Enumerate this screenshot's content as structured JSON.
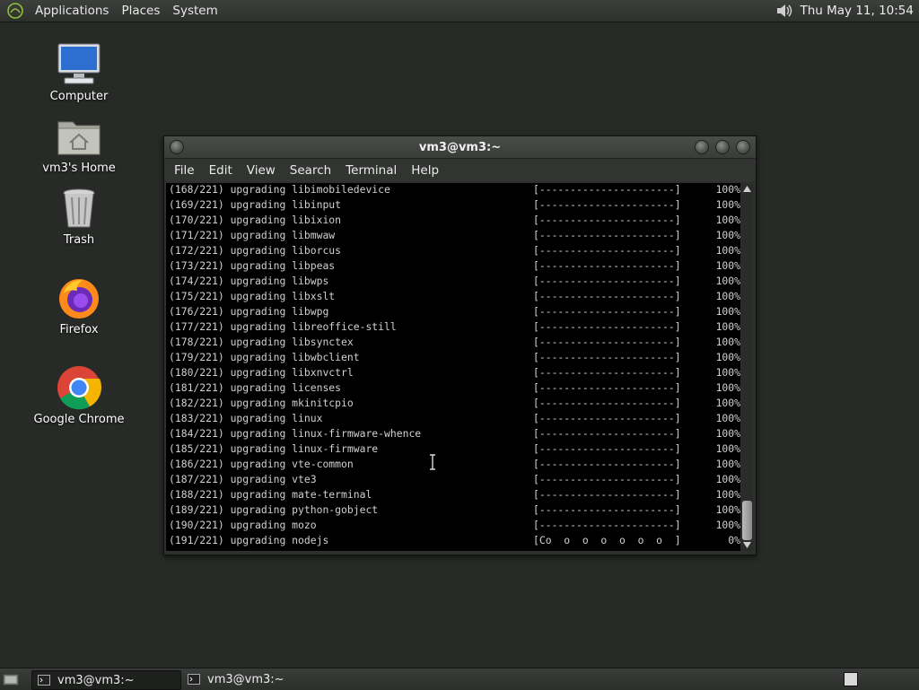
{
  "top_panel": {
    "menus": [
      "Applications",
      "Places",
      "System"
    ],
    "clock": "Thu May 11, 10:54",
    "volume_icon": "speaker-icon"
  },
  "desktop_icons": [
    {
      "label": "Computer",
      "icon": "computer-icon"
    },
    {
      "label": "vm3's Home",
      "icon": "home-folder-icon"
    },
    {
      "label": "Trash",
      "icon": "trash-icon"
    },
    {
      "label": "Firefox",
      "icon": "firefox-icon"
    },
    {
      "label": "Google Chrome",
      "icon": "chrome-icon"
    }
  ],
  "terminal": {
    "title": "vm3@vm3:~",
    "menu": [
      "File",
      "Edit",
      "View",
      "Search",
      "Terminal",
      "Help"
    ],
    "lines": [
      {
        "text": "(168/221) upgrading libimobiledevice",
        "bar": "[----------------------]",
        "pct": "100%"
      },
      {
        "text": "(169/221) upgrading libinput",
        "bar": "[----------------------]",
        "pct": "100%"
      },
      {
        "text": "(170/221) upgrading libixion",
        "bar": "[----------------------]",
        "pct": "100%"
      },
      {
        "text": "(171/221) upgrading libmwaw",
        "bar": "[----------------------]",
        "pct": "100%"
      },
      {
        "text": "(172/221) upgrading liborcus",
        "bar": "[----------------------]",
        "pct": "100%"
      },
      {
        "text": "(173/221) upgrading libpeas",
        "bar": "[----------------------]",
        "pct": "100%"
      },
      {
        "text": "(174/221) upgrading libwps",
        "bar": "[----------------------]",
        "pct": "100%"
      },
      {
        "text": "(175/221) upgrading libxslt",
        "bar": "[----------------------]",
        "pct": "100%"
      },
      {
        "text": "(176/221) upgrading libwpg",
        "bar": "[----------------------]",
        "pct": "100%"
      },
      {
        "text": "(177/221) upgrading libreoffice-still",
        "bar": "[----------------------]",
        "pct": "100%"
      },
      {
        "text": "(178/221) upgrading libsynctex",
        "bar": "[----------------------]",
        "pct": "100%"
      },
      {
        "text": "(179/221) upgrading libwbclient",
        "bar": "[----------------------]",
        "pct": "100%"
      },
      {
        "text": "(180/221) upgrading libxnvctrl",
        "bar": "[----------------------]",
        "pct": "100%"
      },
      {
        "text": "(181/221) upgrading licenses",
        "bar": "[----------------------]",
        "pct": "100%"
      },
      {
        "text": "(182/221) upgrading mkinitcpio",
        "bar": "[----------------------]",
        "pct": "100%"
      },
      {
        "text": "(183/221) upgrading linux",
        "bar": "[----------------------]",
        "pct": "100%"
      },
      {
        "text": "(184/221) upgrading linux-firmware-whence",
        "bar": "[----------------------]",
        "pct": "100%"
      },
      {
        "text": "(185/221) upgrading linux-firmware",
        "bar": "[----------------------]",
        "pct": "100%"
      },
      {
        "text": "(186/221) upgrading vte-common",
        "bar": "[----------------------]",
        "pct": "100%"
      },
      {
        "text": "(187/221) upgrading vte3",
        "bar": "[----------------------]",
        "pct": "100%"
      },
      {
        "text": "(188/221) upgrading mate-terminal",
        "bar": "[----------------------]",
        "pct": "100%"
      },
      {
        "text": "(189/221) upgrading python-gobject",
        "bar": "[----------------------]",
        "pct": "100%"
      },
      {
        "text": "(190/221) upgrading mozo",
        "bar": "[----------------------]",
        "pct": "100%"
      },
      {
        "text": "(191/221) upgrading nodejs",
        "bar": "[Co  o  o  o  o  o  o  ]",
        "pct": "0%"
      }
    ]
  },
  "taskbar": {
    "tasks": [
      {
        "label": "vm3@vm3:~",
        "active": true
      },
      {
        "label": "vm3@vm3:~",
        "active": false
      }
    ]
  }
}
